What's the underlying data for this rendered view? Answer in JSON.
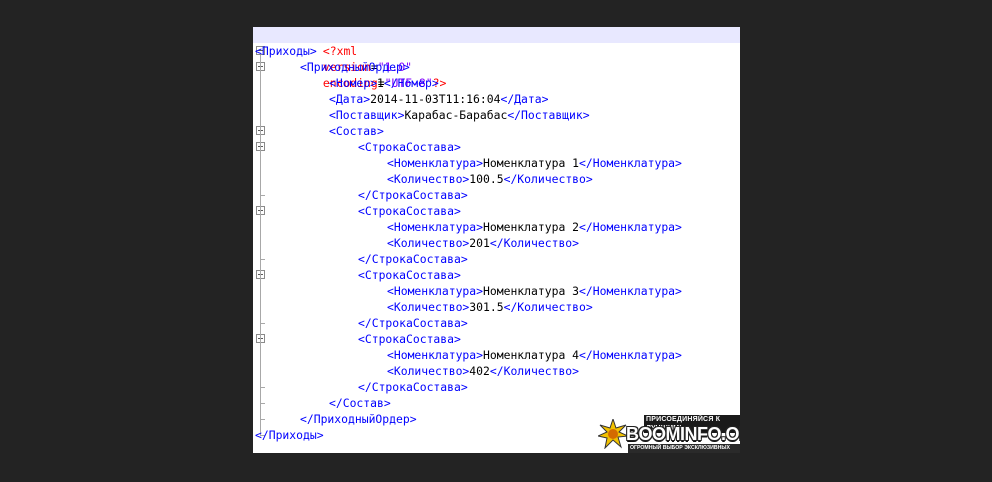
{
  "declaration": {
    "open": "<?xml",
    "version_attr": "version",
    "version_val": "\"1.0\"",
    "encoding_attr": "encoding",
    "encoding_val": "\"UTF-8\"",
    "close": "?>"
  },
  "lines": [
    {
      "indent": 0,
      "open": "<Приходы>",
      "value": "",
      "close": ""
    },
    {
      "indent": 1,
      "open": "<ПриходныйОрдер>",
      "value": "",
      "close": ""
    },
    {
      "indent": 2,
      "open": "<Номер>",
      "value": "1",
      "close": "</Номер>"
    },
    {
      "indent": 2,
      "open": "<Дата>",
      "value": "2014-11-03T11:16:04",
      "close": "</Дата>"
    },
    {
      "indent": 2,
      "open": "<Поставщик>",
      "value": "Карабас-Барабас",
      "close": "</Поставщик>"
    },
    {
      "indent": 2,
      "open": "<Состав>",
      "value": "",
      "close": ""
    },
    {
      "indent": 3,
      "open": "<СтрокаСостава>",
      "value": "",
      "close": ""
    },
    {
      "indent": 4,
      "open": "<Номенклатура>",
      "value": "Номенклатура 1",
      "close": "</Номенклатура>"
    },
    {
      "indent": 4,
      "open": "<Количество>",
      "value": "100.5",
      "close": "</Количество>"
    },
    {
      "indent": 3,
      "open": "</СтрокаСостава>",
      "value": "",
      "close": ""
    },
    {
      "indent": 3,
      "open": "<СтрокаСостава>",
      "value": "",
      "close": ""
    },
    {
      "indent": 4,
      "open": "<Номенклатура>",
      "value": "Номенклатура 2",
      "close": "</Номенклатура>"
    },
    {
      "indent": 4,
      "open": "<Количество>",
      "value": "201",
      "close": "</Количество>"
    },
    {
      "indent": 3,
      "open": "</СтрокаСостава>",
      "value": "",
      "close": ""
    },
    {
      "indent": 3,
      "open": "<СтрокаСостава>",
      "value": "",
      "close": ""
    },
    {
      "indent": 4,
      "open": "<Номенклатура>",
      "value": "Номенклатура 3",
      "close": "</Номенклатура>"
    },
    {
      "indent": 4,
      "open": "<Количество>",
      "value": "301.5",
      "close": "</Количество>"
    },
    {
      "indent": 3,
      "open": "</СтрокаСостава>",
      "value": "",
      "close": ""
    },
    {
      "indent": 3,
      "open": "<СтрокаСостава>",
      "value": "",
      "close": ""
    },
    {
      "indent": 4,
      "open": "<Номенклатура>",
      "value": "Номенклатура 4",
      "close": "</Номенклатура>"
    },
    {
      "indent": 4,
      "open": "<Количество>",
      "value": "402",
      "close": "</Количество>"
    },
    {
      "indent": 3,
      "open": "</СтрокаСостава>",
      "value": "",
      "close": ""
    },
    {
      "indent": 2,
      "open": "</Состав>",
      "value": "",
      "close": ""
    },
    {
      "indent": 1,
      "open": "</ПриходныйОрдер>",
      "value": "",
      "close": ""
    },
    {
      "indent": 0,
      "open": "</Приходы>",
      "value": "",
      "close": ""
    }
  ],
  "watermark": {
    "top": "ПРИСОЕДИНЯЙСЯ К ЛУЧШИМ!",
    "main": "BOOMINFO.ORG",
    "bottom": "ОГРОМНЫЙ ВЫБОР ЭКСКЛЮЗИВНЫХ ТРЕНИНГОВ"
  },
  "colors": {
    "tag": "#0000ff",
    "value": "#000000",
    "declaration": "#ff0000",
    "string": "#8000ff",
    "highlight": "#e8e8ff",
    "background": "#232323"
  }
}
